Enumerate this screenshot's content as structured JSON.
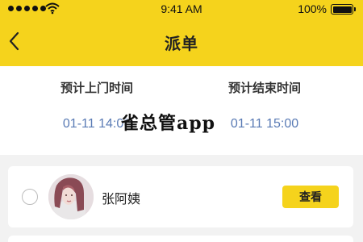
{
  "status_bar": {
    "time": "9:41 AM",
    "battery": "100%"
  },
  "nav": {
    "title": "派单",
    "back_icon": "chevron-left-icon"
  },
  "schedule": {
    "start_label": "预计上门时间",
    "start_value": "01-11 14:00",
    "end_label": "预计结束时间",
    "end_value": "01-11 15:00"
  },
  "watermark": "雀总管app",
  "workers": [
    {
      "name": "张阿姨",
      "action_label": "查看",
      "selected": false
    }
  ],
  "colors": {
    "accent": "#f5d31c",
    "time_value": "#5a7bb5",
    "background": "#f2f2f2"
  }
}
